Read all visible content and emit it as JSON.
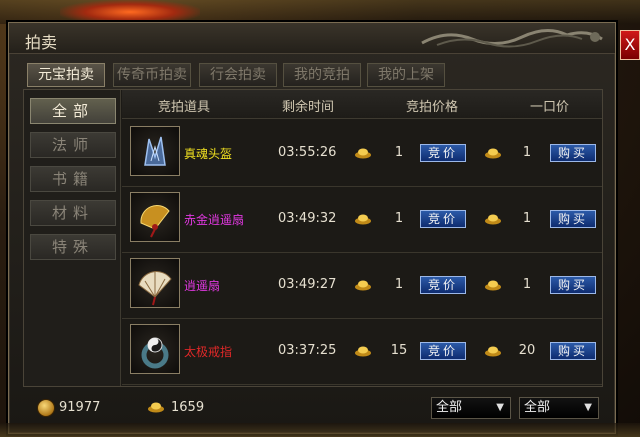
{
  "window": {
    "title": "拍卖",
    "close_label": "X"
  },
  "tabs": [
    {
      "label": "元宝拍卖",
      "active": true
    },
    {
      "label": "传奇币拍卖",
      "active": false
    },
    {
      "label": "行会拍卖",
      "active": false
    },
    {
      "label": "我的竞拍",
      "active": false
    },
    {
      "label": "我的上架",
      "active": false
    }
  ],
  "categories": [
    {
      "label": "全部",
      "active": true
    },
    {
      "label": "法师",
      "active": false
    },
    {
      "label": "书籍",
      "active": false
    },
    {
      "label": "材料",
      "active": false
    },
    {
      "label": "特殊",
      "active": false
    }
  ],
  "columns": {
    "item": "竞拍道具",
    "time": "剩余时间",
    "bid_price": "竞拍价格",
    "buyout": "一口价"
  },
  "rows": [
    {
      "name": "真魂头盔",
      "color": "#f0e020",
      "icon": "helmet-icon",
      "time": "03:55:26",
      "bid": "1",
      "buyout": "1"
    },
    {
      "name": "赤金逍遥扇",
      "color": "#e038e0",
      "icon": "golden-fan-icon",
      "time": "03:49:32",
      "bid": "1",
      "buyout": "1"
    },
    {
      "name": "逍遥扇",
      "color": "#e038e0",
      "icon": "fan-icon",
      "time": "03:49:27",
      "bid": "1",
      "buyout": "1"
    },
    {
      "name": "太极戒指",
      "color": "#e02828",
      "icon": "taiji-ring-icon",
      "time": "03:37:25",
      "bid": "15",
      "buyout": "20"
    }
  ],
  "buttons": {
    "bid": "竞价",
    "buy": "购买"
  },
  "footer": {
    "coin_amount": "91977",
    "ingot_amount": "1659",
    "filter1": "全部",
    "filter2": "全部"
  },
  "colors": {
    "accent_blue": "#2c5aa8",
    "close_red": "#d01818",
    "gold": "#f0c040"
  }
}
